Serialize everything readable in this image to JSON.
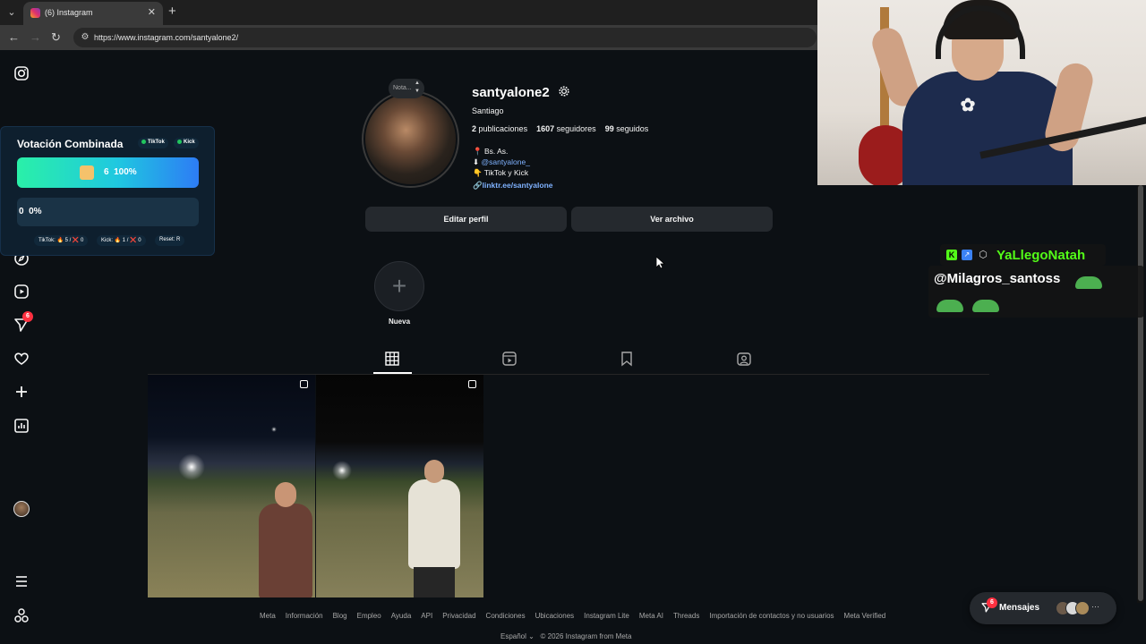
{
  "browser": {
    "tab_title": "(6) Instagram",
    "url": "https://www.instagram.com/santyalone2/",
    "icons": [
      "tab-list-icon",
      "instagram-favicon",
      "close-icon",
      "plus-icon",
      "back-icon",
      "forward-icon",
      "reload-icon",
      "site-settings-icon"
    ]
  },
  "nav": {
    "notifications_badge": "6",
    "icons": [
      "instagram-logo-icon",
      "home-icon",
      "search-icon",
      "explore-icon",
      "reels-icon",
      "messages-icon",
      "heart-icon",
      "create-icon",
      "dashboard-icon",
      "profile-avatar",
      "menu-icon",
      "threads-icon"
    ]
  },
  "vote": {
    "title": "Votación Combinada",
    "tag_tiktok": "TikTok",
    "tag_kick": "Kick",
    "bar1_value": "6",
    "bar1_percent": "100%",
    "bar2_value": "0",
    "bar2_percent": "0%",
    "footer_tiktok": "TikTok: 🔥 5 / ❌ 0",
    "footer_kick": "Kick: 🔥 1 / ❌ 0",
    "footer_reset": "Reset: R",
    "bar1_fill": 1.0,
    "bar2_fill": 0.0,
    "colors": {
      "bar1_start": "#2af0a8",
      "bar1_end": "#2d7cf5"
    }
  },
  "profile": {
    "note_placeholder": "Nota...",
    "username": "santyalone2",
    "full_name": "Santiago",
    "posts_count": "2",
    "posts_label": "publicaciones",
    "followers_count": "1607",
    "followers_label": "seguidores",
    "following_count": "99",
    "following_label": "seguidos",
    "bio_location": "📍 Bs. As.",
    "bio_handle": "@santyalone_",
    "bio_platforms": "👇 TikTok y Kick",
    "bio_link": "linktr.ee/santyalone",
    "edit_button": "Editar perfil",
    "archive_button": "Ver archivo",
    "highlight_new_label": "Nueva"
  },
  "tabs": {
    "icons": [
      "posts-grid-icon",
      "reels-tab-icon",
      "saved-tab-icon",
      "tagged-tab-icon"
    ],
    "active": "posts"
  },
  "footer": {
    "links": [
      "Meta",
      "Información",
      "Blog",
      "Empleo",
      "Ayuda",
      "API",
      "Privacidad",
      "Condiciones",
      "Ubicaciones",
      "Instagram Lite",
      "Meta AI",
      "Threads",
      "Importación de contactos y no usuarios",
      "Meta Verified"
    ],
    "language": "Español",
    "copyright": "© 2026 Instagram from Meta"
  },
  "messages": {
    "label": "Mensajes",
    "badge": "6"
  },
  "chat": {
    "username": "YaLlegoNatah",
    "message": "@Milagros_santoss"
  }
}
